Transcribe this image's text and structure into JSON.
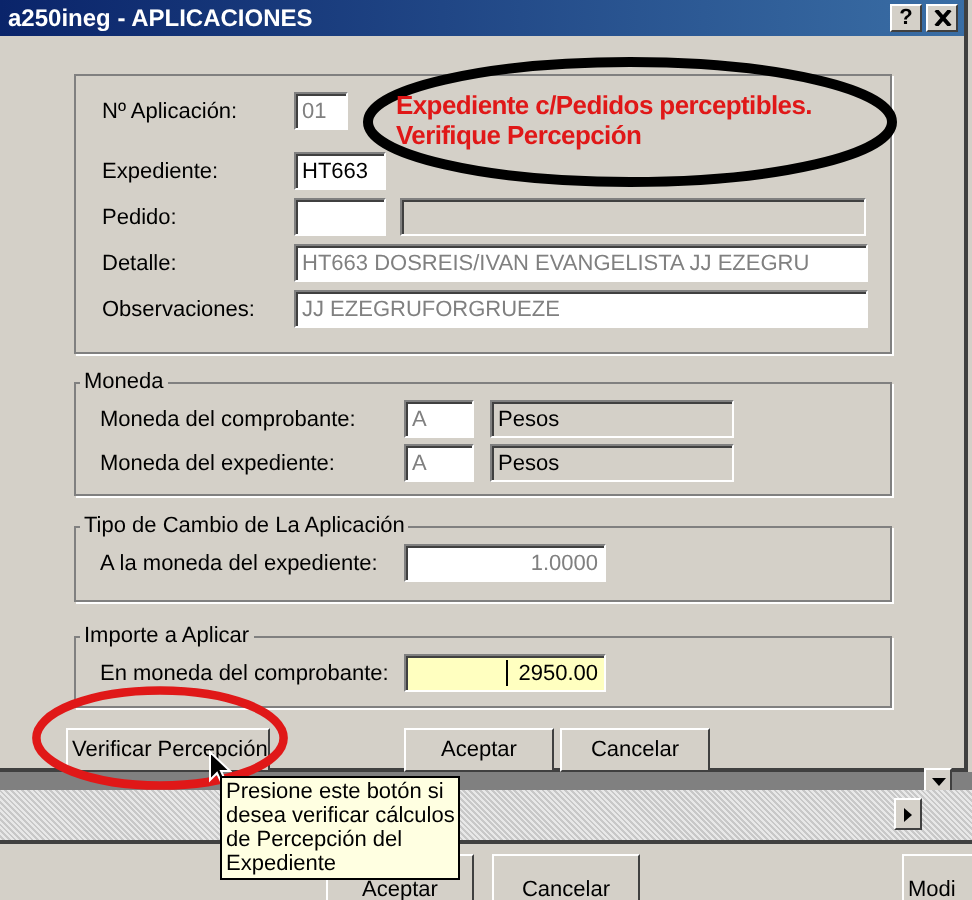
{
  "window": {
    "title": "a250ineg - APLICACIONES",
    "help": "?"
  },
  "note": {
    "lines": [
      "Expediente c/Pedidos perceptibles.",
      "Verifique Percepción"
    ]
  },
  "header_fields": [
    {
      "label": "Nº Aplicación:",
      "value": "01",
      "disabled": true,
      "kind": "narrow"
    },
    {
      "label": "Expediente:",
      "value": "HT663",
      "disabled": false,
      "kind": "short"
    },
    {
      "label": "Pedido:",
      "kind": "short",
      "extra_box": true
    },
    {
      "label": "Detalle:",
      "value": "HT663 DOSREIS/IVAN EVANGELISTA JJ EZEGRU",
      "disabled": true,
      "kind": "wide"
    },
    {
      "label": "Observaciones:",
      "value": "JJ EZEGRUFORGRUEZE",
      "disabled": true,
      "kind": "wide"
    }
  ],
  "moneda": {
    "legend": "Moneda",
    "rows": [
      {
        "label": "Moneda del comprobante:",
        "code": "A",
        "name": "Pesos"
      },
      {
        "label": "Moneda del expediente:",
        "code": "A",
        "name": "Pesos"
      }
    ]
  },
  "tipo_cambio": {
    "legend": "Tipo de Cambio de La Aplicación",
    "label": "A la moneda del expediente:",
    "value": "1.0000",
    "disabled": true
  },
  "importe": {
    "legend": "Importe a Aplicar",
    "label": "En moneda del comprobante:",
    "value": "2950.00",
    "focused": true
  },
  "buttons": [
    "Verificar Percepción",
    "Aceptar",
    "Cancelar"
  ],
  "tooltip": {
    "lines": [
      "Presione este botón si",
      "desea verificar cálculos",
      "de Percepción del",
      "Expediente"
    ]
  },
  "background_buttons": [
    "Aceptar",
    "Cancelar",
    "Modi"
  ]
}
